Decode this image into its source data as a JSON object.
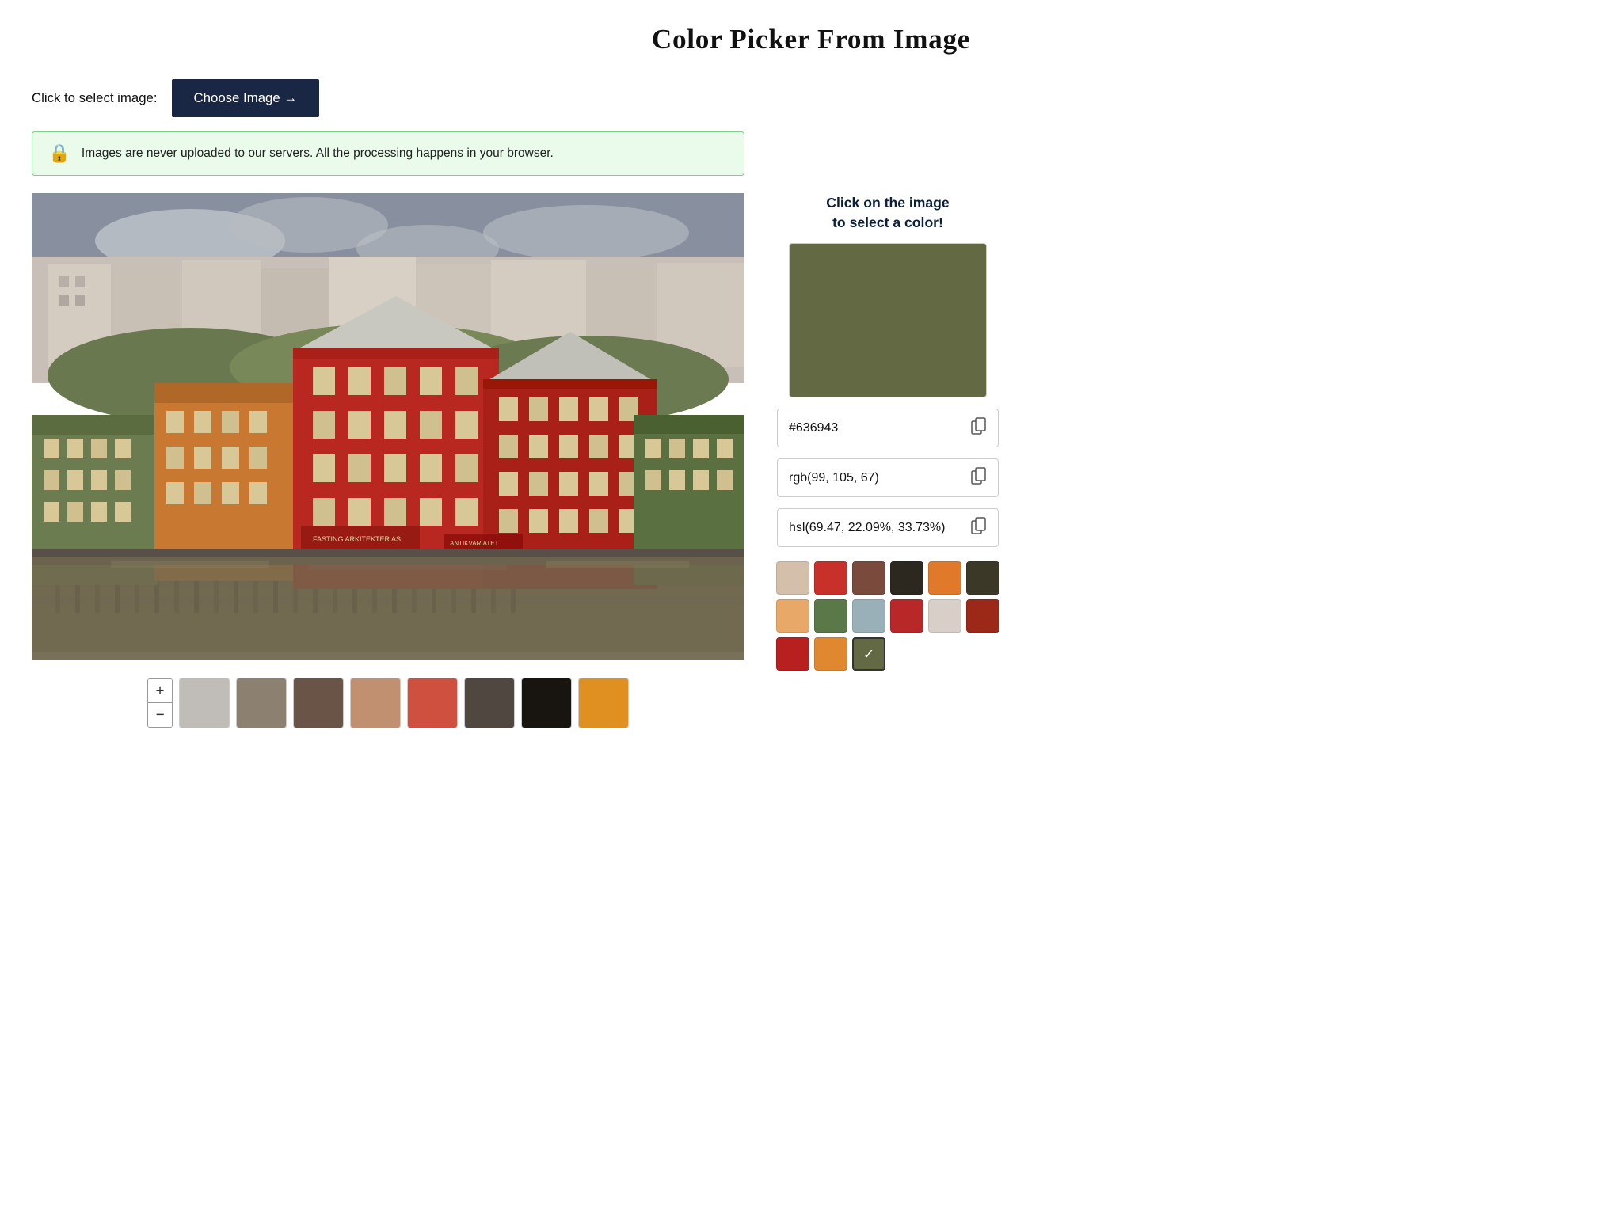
{
  "page": {
    "title": "Color Picker From Image"
  },
  "header": {
    "click_label": "Click to select image:",
    "choose_button": "Choose Image →"
  },
  "privacy_banner": {
    "text": "Images are never uploaded to our servers. All the processing happens in your browser."
  },
  "right_panel": {
    "instruction": "Click on the image\nto select a color!",
    "hex_value": "#636943",
    "rgb_value": "rgb(99, 105, 67)",
    "hsl_value": "hsl(69.47, 22.09%, 33.73%)",
    "selected_color": "#636943"
  },
  "mini_swatches": [
    {
      "color": "#d4bfaa",
      "row": 0
    },
    {
      "color": "#c8302a",
      "row": 0
    },
    {
      "color": "#7a4a3c",
      "row": 0
    },
    {
      "color": "#2c2820",
      "row": 0
    },
    {
      "color": "#e07a2a",
      "row": 0
    },
    {
      "color": "#3c3828",
      "row": 0
    },
    {
      "color": "#e8a868",
      "row": 1
    },
    {
      "color": "#5a7848",
      "row": 1
    },
    {
      "color": "#9ab0b8",
      "row": 1
    },
    {
      "color": "#b82828",
      "row": 1
    },
    {
      "color": "#d8d0c8",
      "row": 1
    },
    {
      "color": "#9c2818",
      "row": 1
    },
    {
      "color": "#b82020",
      "row": 2
    },
    {
      "color": "#e08830",
      "row": 2
    },
    {
      "color": "#636943",
      "row": 2,
      "selected": true
    }
  ],
  "bottom_palette": [
    {
      "color": "#c0bdb8"
    },
    {
      "color": "#8c8070"
    },
    {
      "color": "#6a5448"
    },
    {
      "color": "#c09070"
    },
    {
      "color": "#d05040"
    },
    {
      "color": "#504840"
    },
    {
      "color": "#181410"
    },
    {
      "color": "#e09020"
    }
  ],
  "icons": {
    "lock": "🔒",
    "copy": "📋",
    "checkmark": "✓"
  }
}
